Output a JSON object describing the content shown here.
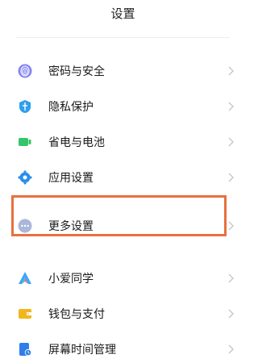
{
  "header": {
    "title": "设置"
  },
  "group1": [
    {
      "label": "密码与安全",
      "icon": "fingerprint-icon",
      "color": "#7a79f0"
    },
    {
      "label": "隐私保护",
      "icon": "privacy-shield-icon",
      "color": "#2ea0ee"
    },
    {
      "label": "省电与电池",
      "icon": "battery-icon",
      "color": "#36c46a"
    },
    {
      "label": "应用设置",
      "icon": "app-settings-gear-icon",
      "color": "#2a8fea"
    },
    {
      "label": "更多设置",
      "icon": "more-dots-icon",
      "color": "#aab7d9"
    }
  ],
  "group2": [
    {
      "label": "小爱同学",
      "icon": "xiaoai-assistant-icon",
      "color": "#3aa6ff"
    },
    {
      "label": "钱包与支付",
      "icon": "wallet-icon",
      "color": "#f2b61d"
    },
    {
      "label": "屏幕时间管理",
      "icon": "screen-time-icon",
      "color": "#2f7de9"
    }
  ],
  "highlight_color": "#e8703f"
}
